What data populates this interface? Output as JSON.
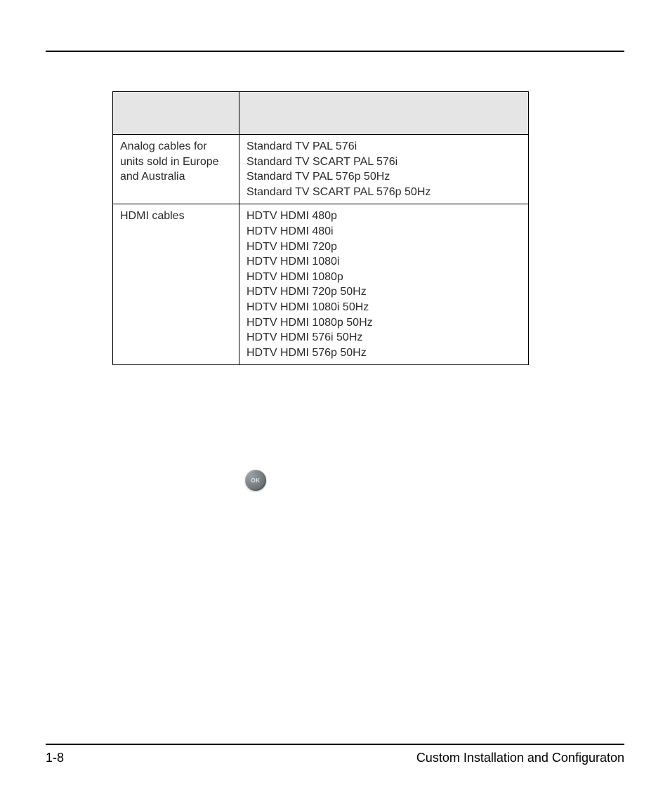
{
  "table": {
    "rows": [
      {
        "label": "Analog cables for units sold in Europe and Australia",
        "items": [
          "Standard TV PAL 576i",
          "Standard TV SCART PAL 576i",
          "Standard TV PAL 576p 50Hz",
          "Standard TV SCART PAL 576p 50Hz"
        ]
      },
      {
        "label": "HDMI cables",
        "items": [
          "HDTV HDMI 480p",
          "HDTV HDMI 480i",
          "HDTV HDMI 720p",
          "HDTV HDMI 1080i",
          "HDTV HDMI 1080p",
          "HDTV HDMI 720p 50Hz",
          "HDTV HDMI 1080i 50Hz",
          "HDTV HDMI 1080p 50Hz",
          "HDTV HDMI 576i 50Hz",
          "HDTV HDMI 576p 50Hz"
        ]
      }
    ]
  },
  "ok_label": "OK",
  "footer": {
    "page_num": "1-8",
    "title": "Custom Installation and Configuraton"
  }
}
